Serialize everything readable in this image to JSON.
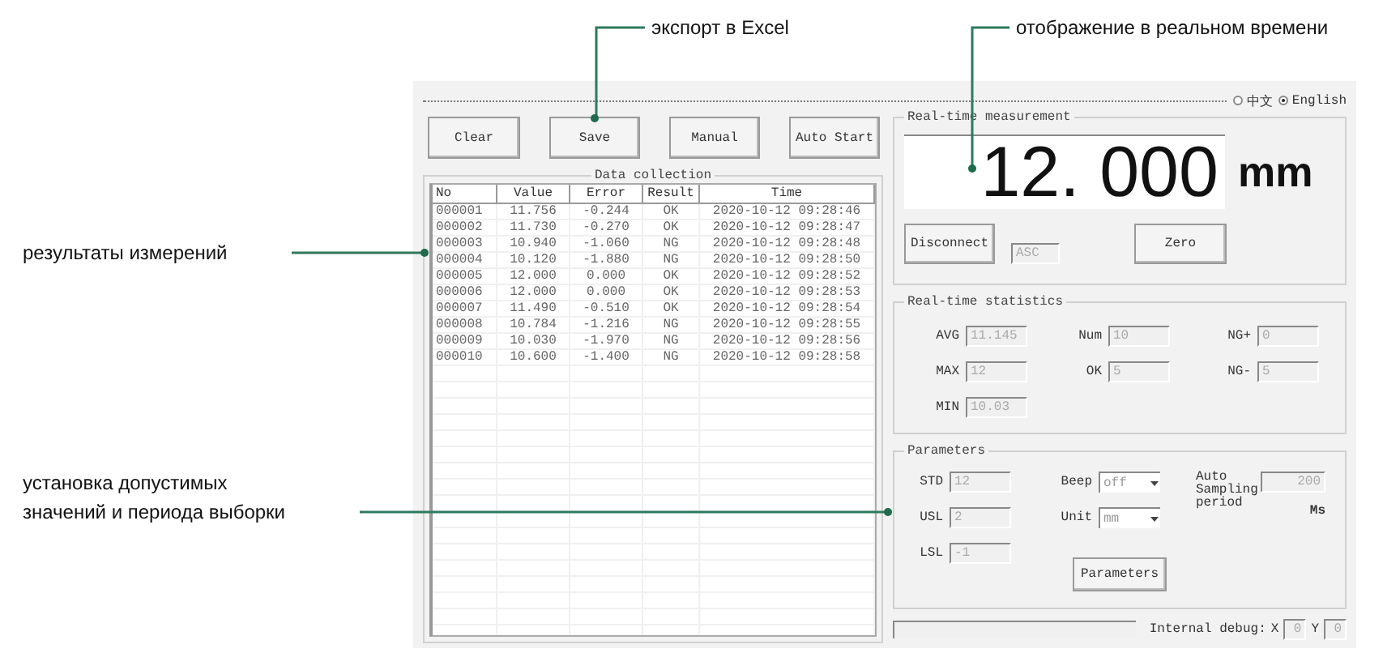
{
  "annotations": [
    {
      "text": "экспорт в Excel"
    },
    {
      "text": "отображение в реальном времени"
    },
    {
      "text": "результаты измерений"
    },
    {
      "text": "установка допустимых\nзначений и периода выборки"
    }
  ],
  "language_options": [
    {
      "label": "中文",
      "selected": false
    },
    {
      "label": "English",
      "selected": true
    }
  ],
  "toolbar_buttons": [
    "Clear",
    "Save",
    "Manual",
    "Auto Start"
  ],
  "data_collection": {
    "title": "Data collection",
    "columns": [
      "No",
      "Value",
      "Error",
      "Result",
      "Time"
    ],
    "rows": [
      [
        "000001",
        "11.756",
        "-0.244",
        "OK",
        "2020-10-12 09:28:46"
      ],
      [
        "000002",
        "11.730",
        "-0.270",
        "OK",
        "2020-10-12 09:28:47"
      ],
      [
        "000003",
        "10.940",
        "-1.060",
        "NG",
        "2020-10-12 09:28:48"
      ],
      [
        "000004",
        "10.120",
        "-1.880",
        "NG",
        "2020-10-12 09:28:50"
      ],
      [
        "000005",
        "12.000",
        "0.000",
        "OK",
        "2020-10-12 09:28:52"
      ],
      [
        "000006",
        "12.000",
        "0.000",
        "OK",
        "2020-10-12 09:28:53"
      ],
      [
        "000007",
        "11.490",
        "-0.510",
        "OK",
        "2020-10-12 09:28:54"
      ],
      [
        "000008",
        "10.784",
        "-1.216",
        "NG",
        "2020-10-12 09:28:55"
      ],
      [
        "000009",
        "10.030",
        "-1.970",
        "NG",
        "2020-10-12 09:28:56"
      ],
      [
        "000010",
        "10.600",
        "-1.400",
        "NG",
        "2020-10-12 09:28:58"
      ]
    ]
  },
  "measurement": {
    "title": "Real-time measurement",
    "reading": "12. 000",
    "unit": "mm",
    "disconnect_button": "Disconnect",
    "mode": "ASC",
    "zero_button": "Zero"
  },
  "statistics": {
    "title": "Real-time statistics",
    "fields": [
      {
        "label": "AVG",
        "value": "11.145"
      },
      {
        "label": "Num",
        "value": "10"
      },
      {
        "label": "NG+",
        "value": "0"
      },
      {
        "label": "MAX",
        "value": "12"
      },
      {
        "label": "OK",
        "value": "5"
      },
      {
        "label": "NG-",
        "value": "5"
      },
      {
        "label": "MIN",
        "value": "10.03"
      }
    ]
  },
  "parameters": {
    "title": "Parameters",
    "fields": [
      {
        "label": "STD",
        "value": "12"
      },
      {
        "label": "USL",
        "value": "2"
      },
      {
        "label": "LSL",
        "value": "-1"
      }
    ],
    "selects": [
      {
        "label": "Beep",
        "value": "off"
      },
      {
        "label": "Unit",
        "value": "mm"
      }
    ],
    "sampling": {
      "label": "Auto Sampling period",
      "value": "200",
      "unit": "Ms"
    },
    "button": "Parameters"
  },
  "status_bar": {
    "debug_label": "Internal debug:",
    "debug": [
      {
        "label": "X",
        "value": "0"
      },
      {
        "label": "Y",
        "value": "0"
      }
    ]
  }
}
